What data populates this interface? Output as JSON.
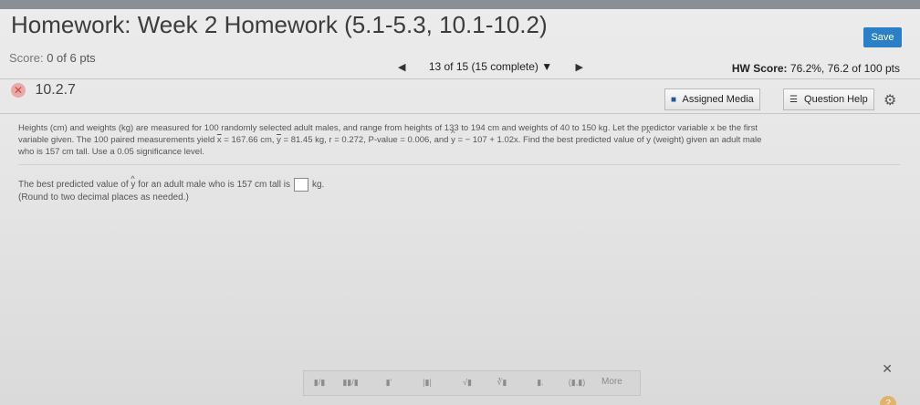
{
  "header": {
    "title": "Homework: Week 2 Homework (5.1-5.3, 10.1-10.2)",
    "save_label": "Save"
  },
  "score_row": {
    "score_label": "Score:",
    "score_value": "0 of 6 pts",
    "nav_text": "13 of 15 (15 complete) ▼",
    "hw_score_label": "HW Score:",
    "hw_score_value": "76.2%, 76.2 of 100 pts"
  },
  "question": {
    "id": "10.2.7",
    "assigned_media_label": "Assigned Media",
    "question_help_label": "Question Help"
  },
  "problem": {
    "p1": "Heights (cm) and weights (kg) are measured for 100 randomly selected adult males, and range from heights of 133 to 194 cm and weights of 40 to 150 kg. Let the predictor variable x be the first",
    "p2a": "variable given. The 100 paired measurements yield ",
    "x_bar": "x",
    "p2b": " = 167.66 cm, ",
    "y_bar": "y",
    "p2c": " = 81.45 kg, r = 0.272, P-value = 0.006, and ",
    "y_hat": "y",
    "p2d": " = − 107 + 1.02x. Find the best predicted value of ",
    "y_hat2": "y",
    "p2e": " (weight) given an adult male",
    "p3": "who is 157 cm tall. Use a 0.05 significance level."
  },
  "answer": {
    "a1": "The best predicted value of ",
    "y_hat": "y",
    "a2": " for an adult male who is 157 cm tall is",
    "unit": "kg.",
    "note": "(Round to two decimal places as needed.)"
  },
  "math_toolbar": {
    "buttons": [
      "▮/▮",
      "▮▮/▮",
      "▮'",
      "|▮|",
      "√▮",
      "∛▮",
      "▮.",
      "(▮,▮)"
    ],
    "more_label": "More"
  },
  "help_corner": "?"
}
